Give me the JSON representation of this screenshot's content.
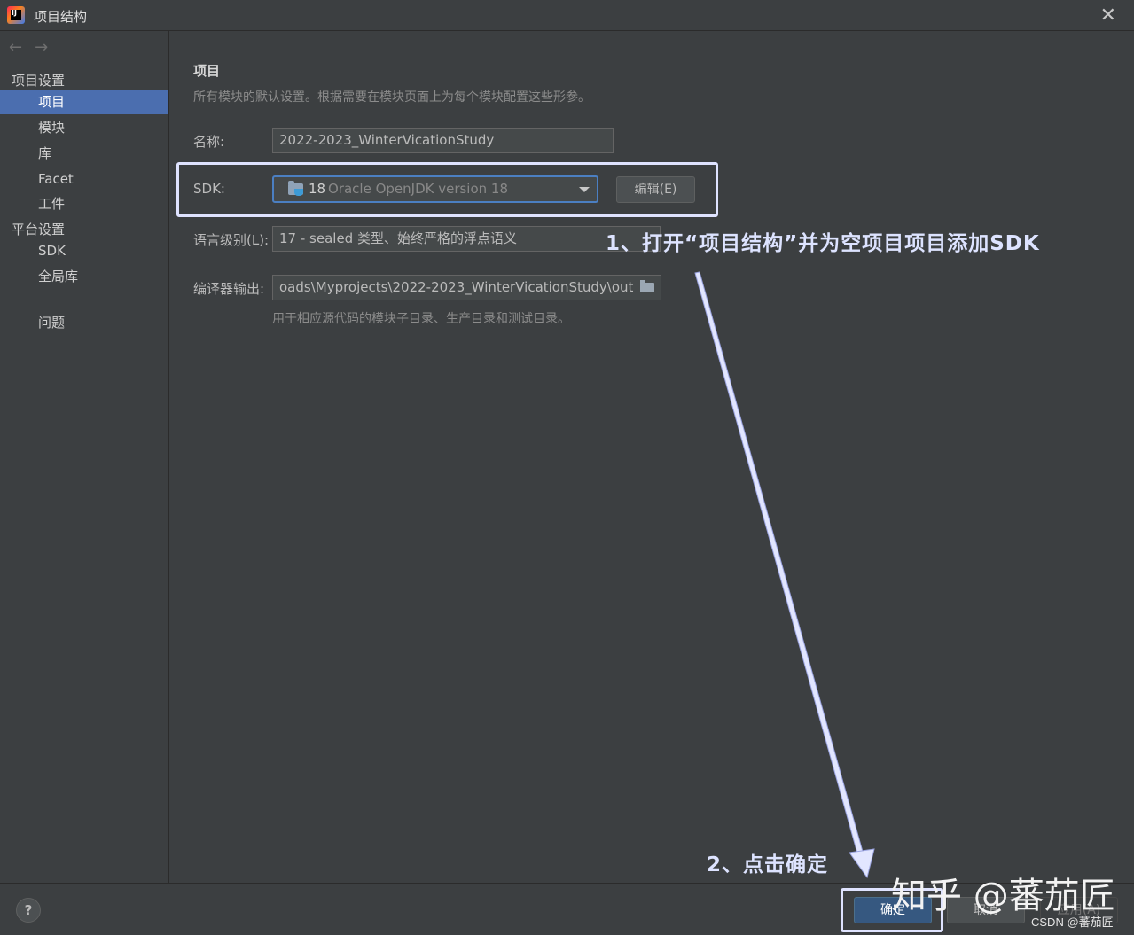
{
  "window": {
    "title": "项目结构"
  },
  "sidebar": {
    "back_glyph": "←",
    "forward_glyph": "→",
    "project_settings_heading": "项目设置",
    "project_items": [
      "项目",
      "模块",
      "库",
      "Facet",
      "工件"
    ],
    "platform_settings_heading": "平台设置",
    "platform_items": [
      "SDK",
      "全局库"
    ],
    "problems_item": "问题",
    "selected": "项目"
  },
  "main": {
    "title": "项目",
    "description": "所有模块的默认设置。根据需要在模块页面上为每个模块配置这些形参。",
    "name_label": "名称:",
    "name_value": "2022-2023_WinterVicationStudy",
    "sdk_label": "SDK:",
    "sdk_version": "18",
    "sdk_name": "Oracle OpenJDK version 18",
    "edit_button": "编辑(E)",
    "language_level_label": "语言级别(L):",
    "language_level_value": "17 - sealed 类型、始终严格的浮点语义",
    "compiler_output_label": "编译器输出:",
    "compiler_output_value": "oads\\Myprojects\\2022-2023_WinterVicationStudy\\out",
    "compiler_output_hint": "用于相应源代码的模块子目录、生产目录和测试目录。"
  },
  "footer": {
    "help": "?",
    "ok": "确定",
    "cancel": "取消",
    "apply": "应用(A)"
  },
  "annotations": {
    "step1": "1、打开“项目结构”并为空项目项目添加SDK",
    "step2": "2、点击确定",
    "color": "#dde3ff"
  },
  "watermark": {
    "text": "知乎 @蕃茄匠",
    "credit": "CSDN @蕃茄匠"
  },
  "colors": {
    "background": "#3c3f41",
    "selection": "#4b6eaf",
    "primary_button": "#365880",
    "focus_border": "#4b7fc2"
  }
}
